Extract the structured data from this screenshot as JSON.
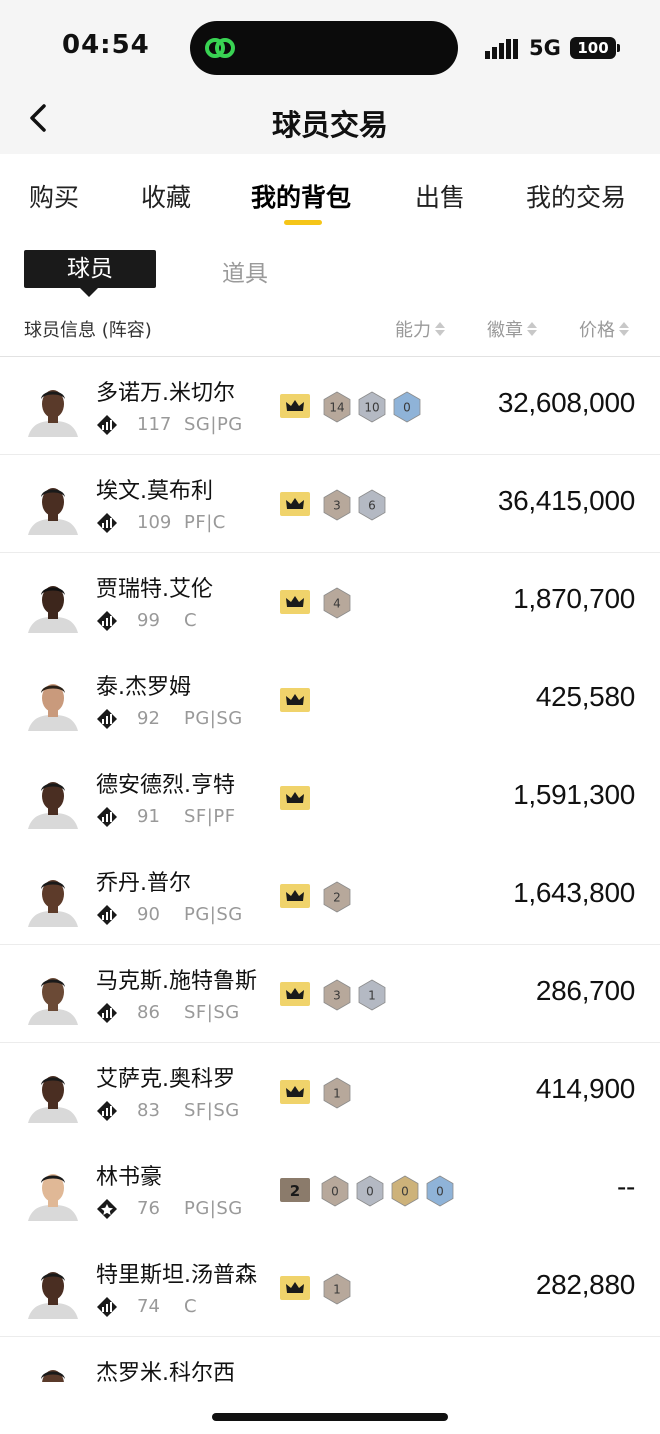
{
  "status_bar": {
    "time": "04:54",
    "network": "5G",
    "battery": "100"
  },
  "nav": {
    "title": "球员交易"
  },
  "tabs": [
    {
      "label": "购买",
      "active": false
    },
    {
      "label": "收藏",
      "active": false
    },
    {
      "label": "我的背包",
      "active": true
    },
    {
      "label": "出售",
      "active": false
    },
    {
      "label": "我的交易",
      "active": false
    }
  ],
  "sub_tabs": {
    "player": "球员",
    "item": "道具"
  },
  "list_header": {
    "info": "球员信息 (阵容)",
    "ability": "能力",
    "badge": "徽章",
    "price": "价格"
  },
  "players": [
    {
      "name": "多诺万.米切尔",
      "rating": "117",
      "pos": "SG|PG",
      "price": "32,608,000",
      "crown": true,
      "badges": [
        {
          "v": "14",
          "t": "bronze"
        },
        {
          "v": "10",
          "t": "silver"
        },
        {
          "v": "0",
          "t": "blue"
        }
      ]
    },
    {
      "name": "埃文.莫布利",
      "rating": "109",
      "pos": "PF|C",
      "price": "36,415,000",
      "crown": true,
      "badges": [
        {
          "v": "3",
          "t": "bronze"
        },
        {
          "v": "6",
          "t": "silver"
        }
      ]
    },
    {
      "name": "贾瑞特.艾伦",
      "rating": "99",
      "pos": "C",
      "price": "1,870,700",
      "crown": true,
      "badges": [
        {
          "v": "4",
          "t": "bronze"
        }
      ]
    },
    {
      "name": "泰.杰罗姆",
      "rating": "92",
      "pos": "PG|SG",
      "price": "425,580",
      "crown": true,
      "badges": []
    },
    {
      "name": "德安德烈.亨特",
      "rating": "91",
      "pos": "SF|PF",
      "price": "1,591,300",
      "crown": true,
      "badges": []
    },
    {
      "name": "乔丹.普尔",
      "rating": "90",
      "pos": "PG|SG",
      "price": "1,643,800",
      "crown": true,
      "badges": [
        {
          "v": "2",
          "t": "bronze"
        }
      ]
    },
    {
      "name": "马克斯.施特鲁斯",
      "rating": "86",
      "pos": "SF|SG",
      "price": "286,700",
      "crown": true,
      "badges": [
        {
          "v": "3",
          "t": "bronze"
        },
        {
          "v": "1",
          "t": "silver"
        }
      ]
    },
    {
      "name": "艾萨克.奥科罗",
      "rating": "83",
      "pos": "SF|SG",
      "price": "414,900",
      "crown": true,
      "badges": [
        {
          "v": "1",
          "t": "bronze"
        }
      ]
    },
    {
      "name": "林书豪",
      "rating": "76",
      "pos": "PG|SG",
      "price": "--",
      "crown": false,
      "level": "2",
      "badges": [
        {
          "v": "0",
          "t": "bronze"
        },
        {
          "v": "0",
          "t": "silver"
        },
        {
          "v": "0",
          "t": "gold"
        },
        {
          "v": "0",
          "t": "blue"
        }
      ]
    },
    {
      "name": "特里斯坦.汤普森",
      "rating": "74",
      "pos": "C",
      "price": "282,880",
      "crown": true,
      "badges": [
        {
          "v": "1",
          "t": "bronze"
        }
      ]
    },
    {
      "name": "杰罗米.科尔西",
      "rating": "",
      "pos": "",
      "price": "",
      "crown": false,
      "badges": []
    }
  ],
  "colors": {
    "accent": "#f5c518",
    "crown_bg": "#f0d36b",
    "badge_bronze": "#b7a89b",
    "badge_silver": "#b4b9c3",
    "badge_gold": "#cdb27a",
    "badge_blue": "#8fb3d8",
    "level_bg": "#8b7b6b"
  },
  "icons": {
    "back": "chevron-left-icon",
    "rank": "rank-diamond-icon",
    "crown": "crown-icon",
    "sort": "sort-arrows-icon"
  }
}
